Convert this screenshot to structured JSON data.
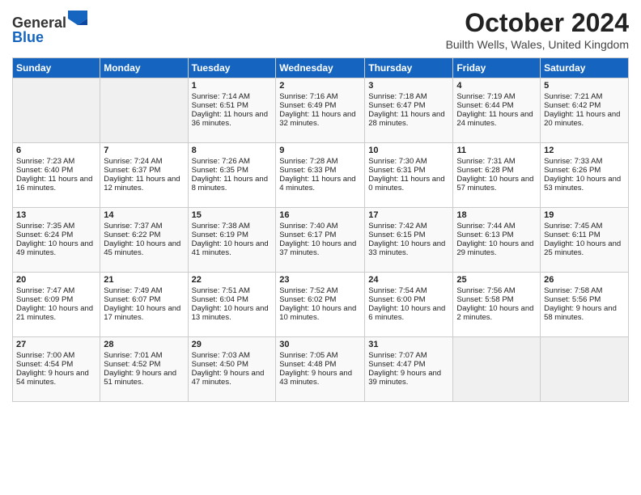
{
  "header": {
    "logo_line1": "General",
    "logo_line2": "Blue",
    "month_title": "October 2024",
    "location": "Builth Wells, Wales, United Kingdom"
  },
  "weekdays": [
    "Sunday",
    "Monday",
    "Tuesday",
    "Wednesday",
    "Thursday",
    "Friday",
    "Saturday"
  ],
  "weeks": [
    [
      {
        "day": "",
        "text": ""
      },
      {
        "day": "",
        "text": ""
      },
      {
        "day": "1",
        "text": "Sunrise: 7:14 AM\nSunset: 6:51 PM\nDaylight: 11 hours and 36 minutes."
      },
      {
        "day": "2",
        "text": "Sunrise: 7:16 AM\nSunset: 6:49 PM\nDaylight: 11 hours and 32 minutes."
      },
      {
        "day": "3",
        "text": "Sunrise: 7:18 AM\nSunset: 6:47 PM\nDaylight: 11 hours and 28 minutes."
      },
      {
        "day": "4",
        "text": "Sunrise: 7:19 AM\nSunset: 6:44 PM\nDaylight: 11 hours and 24 minutes."
      },
      {
        "day": "5",
        "text": "Sunrise: 7:21 AM\nSunset: 6:42 PM\nDaylight: 11 hours and 20 minutes."
      }
    ],
    [
      {
        "day": "6",
        "text": "Sunrise: 7:23 AM\nSunset: 6:40 PM\nDaylight: 11 hours and 16 minutes."
      },
      {
        "day": "7",
        "text": "Sunrise: 7:24 AM\nSunset: 6:37 PM\nDaylight: 11 hours and 12 minutes."
      },
      {
        "day": "8",
        "text": "Sunrise: 7:26 AM\nSunset: 6:35 PM\nDaylight: 11 hours and 8 minutes."
      },
      {
        "day": "9",
        "text": "Sunrise: 7:28 AM\nSunset: 6:33 PM\nDaylight: 11 hours and 4 minutes."
      },
      {
        "day": "10",
        "text": "Sunrise: 7:30 AM\nSunset: 6:31 PM\nDaylight: 11 hours and 0 minutes."
      },
      {
        "day": "11",
        "text": "Sunrise: 7:31 AM\nSunset: 6:28 PM\nDaylight: 10 hours and 57 minutes."
      },
      {
        "day": "12",
        "text": "Sunrise: 7:33 AM\nSunset: 6:26 PM\nDaylight: 10 hours and 53 minutes."
      }
    ],
    [
      {
        "day": "13",
        "text": "Sunrise: 7:35 AM\nSunset: 6:24 PM\nDaylight: 10 hours and 49 minutes."
      },
      {
        "day": "14",
        "text": "Sunrise: 7:37 AM\nSunset: 6:22 PM\nDaylight: 10 hours and 45 minutes."
      },
      {
        "day": "15",
        "text": "Sunrise: 7:38 AM\nSunset: 6:19 PM\nDaylight: 10 hours and 41 minutes."
      },
      {
        "day": "16",
        "text": "Sunrise: 7:40 AM\nSunset: 6:17 PM\nDaylight: 10 hours and 37 minutes."
      },
      {
        "day": "17",
        "text": "Sunrise: 7:42 AM\nSunset: 6:15 PM\nDaylight: 10 hours and 33 minutes."
      },
      {
        "day": "18",
        "text": "Sunrise: 7:44 AM\nSunset: 6:13 PM\nDaylight: 10 hours and 29 minutes."
      },
      {
        "day": "19",
        "text": "Sunrise: 7:45 AM\nSunset: 6:11 PM\nDaylight: 10 hours and 25 minutes."
      }
    ],
    [
      {
        "day": "20",
        "text": "Sunrise: 7:47 AM\nSunset: 6:09 PM\nDaylight: 10 hours and 21 minutes."
      },
      {
        "day": "21",
        "text": "Sunrise: 7:49 AM\nSunset: 6:07 PM\nDaylight: 10 hours and 17 minutes."
      },
      {
        "day": "22",
        "text": "Sunrise: 7:51 AM\nSunset: 6:04 PM\nDaylight: 10 hours and 13 minutes."
      },
      {
        "day": "23",
        "text": "Sunrise: 7:52 AM\nSunset: 6:02 PM\nDaylight: 10 hours and 10 minutes."
      },
      {
        "day": "24",
        "text": "Sunrise: 7:54 AM\nSunset: 6:00 PM\nDaylight: 10 hours and 6 minutes."
      },
      {
        "day": "25",
        "text": "Sunrise: 7:56 AM\nSunset: 5:58 PM\nDaylight: 10 hours and 2 minutes."
      },
      {
        "day": "26",
        "text": "Sunrise: 7:58 AM\nSunset: 5:56 PM\nDaylight: 9 hours and 58 minutes."
      }
    ],
    [
      {
        "day": "27",
        "text": "Sunrise: 7:00 AM\nSunset: 4:54 PM\nDaylight: 9 hours and 54 minutes."
      },
      {
        "day": "28",
        "text": "Sunrise: 7:01 AM\nSunset: 4:52 PM\nDaylight: 9 hours and 51 minutes."
      },
      {
        "day": "29",
        "text": "Sunrise: 7:03 AM\nSunset: 4:50 PM\nDaylight: 9 hours and 47 minutes."
      },
      {
        "day": "30",
        "text": "Sunrise: 7:05 AM\nSunset: 4:48 PM\nDaylight: 9 hours and 43 minutes."
      },
      {
        "day": "31",
        "text": "Sunrise: 7:07 AM\nSunset: 4:47 PM\nDaylight: 9 hours and 39 minutes."
      },
      {
        "day": "",
        "text": ""
      },
      {
        "day": "",
        "text": ""
      }
    ]
  ]
}
